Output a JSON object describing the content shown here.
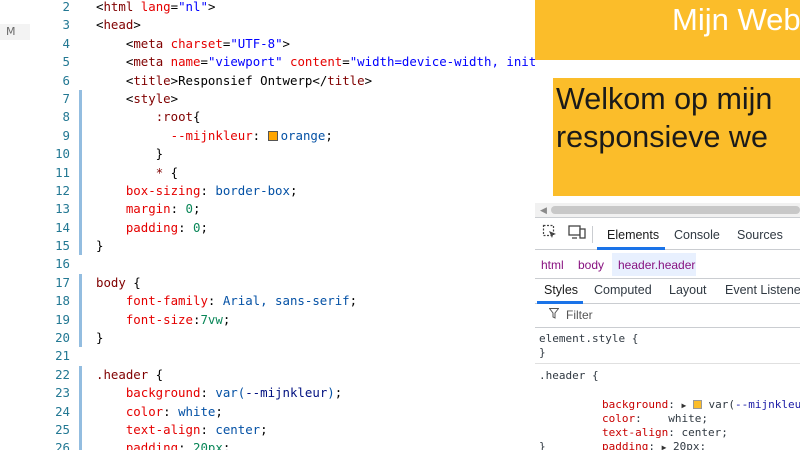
{
  "editor": {
    "git_badge": "M",
    "lines": [
      {
        "n": "2",
        "mod": false,
        "tokens": [
          [
            "t-punc",
            "<"
          ],
          [
            "t-tag",
            "html"
          ],
          [
            "t-punc",
            " "
          ],
          [
            "t-attr",
            "lang"
          ],
          [
            "t-punc",
            "="
          ],
          [
            "t-str",
            "\"nl\""
          ],
          [
            "t-punc",
            ">"
          ]
        ]
      },
      {
        "n": "3",
        "mod": false,
        "tokens": [
          [
            "t-punc",
            "<"
          ],
          [
            "t-tag",
            "head"
          ],
          [
            "t-punc",
            ">"
          ]
        ]
      },
      {
        "n": "4",
        "mod": false,
        "tokens": [
          [
            "t-punc",
            "    <"
          ],
          [
            "t-tag",
            "meta"
          ],
          [
            "t-punc",
            " "
          ],
          [
            "t-attr",
            "charset"
          ],
          [
            "t-punc",
            "="
          ],
          [
            "t-str",
            "\"UTF-8\""
          ],
          [
            "t-punc",
            ">"
          ]
        ]
      },
      {
        "n": "5",
        "mod": false,
        "tokens": [
          [
            "t-punc",
            "    <"
          ],
          [
            "t-tag",
            "meta"
          ],
          [
            "t-punc",
            " "
          ],
          [
            "t-attr",
            "name"
          ],
          [
            "t-punc",
            "="
          ],
          [
            "t-str",
            "\"viewport\""
          ],
          [
            "t-punc",
            " "
          ],
          [
            "t-attr",
            "content"
          ],
          [
            "t-punc",
            "="
          ],
          [
            "t-str",
            "\"width=device-width, init"
          ]
        ]
      },
      {
        "n": "6",
        "mod": false,
        "tokens": [
          [
            "t-punc",
            "    <"
          ],
          [
            "t-tag",
            "title"
          ],
          [
            "t-punc",
            ">Responsief Ontwerp</"
          ],
          [
            "t-tag",
            "title"
          ],
          [
            "t-punc",
            ">"
          ]
        ]
      },
      {
        "n": "7",
        "mod": true,
        "tokens": [
          [
            "t-punc",
            "    <"
          ],
          [
            "t-tag",
            "style"
          ],
          [
            "t-punc",
            ">"
          ]
        ]
      },
      {
        "n": "8",
        "mod": true,
        "tokens": [
          [
            "t-punc",
            "        "
          ],
          [
            "t-sel",
            ":root"
          ],
          [
            "t-punc",
            "{"
          ]
        ]
      },
      {
        "n": "9",
        "mod": true,
        "swatch_after": 1,
        "swatch_color": "orange",
        "tokens": [
          [
            "t-punc",
            "          "
          ],
          [
            "t-prop",
            "--mijnkleur"
          ],
          [
            "t-punc",
            ": "
          ],
          [
            "t-val",
            "orange"
          ],
          [
            "t-punc",
            ";"
          ]
        ]
      },
      {
        "n": "10",
        "mod": true,
        "tokens": [
          [
            "t-punc",
            "        }"
          ]
        ]
      },
      {
        "n": "11",
        "mod": true,
        "tokens": [
          [
            "t-punc",
            "        "
          ],
          [
            "t-sel",
            "* "
          ],
          [
            "t-punc",
            "{"
          ]
        ]
      },
      {
        "n": "12",
        "mod": true,
        "tokens": [
          [
            "t-punc",
            "    "
          ],
          [
            "t-prop",
            "box-sizing"
          ],
          [
            "t-punc",
            ": "
          ],
          [
            "t-val",
            "border-box"
          ],
          [
            "t-punc",
            ";"
          ]
        ]
      },
      {
        "n": "13",
        "mod": true,
        "tokens": [
          [
            "t-punc",
            "    "
          ],
          [
            "t-prop",
            "margin"
          ],
          [
            "t-punc",
            ": "
          ],
          [
            "t-num",
            "0"
          ],
          [
            "t-punc",
            ";"
          ]
        ]
      },
      {
        "n": "14",
        "mod": true,
        "tokens": [
          [
            "t-punc",
            "    "
          ],
          [
            "t-prop",
            "padding"
          ],
          [
            "t-punc",
            ": "
          ],
          [
            "t-num",
            "0"
          ],
          [
            "t-punc",
            ";"
          ]
        ]
      },
      {
        "n": "15",
        "mod": true,
        "tokens": [
          [
            "t-punc",
            "}"
          ]
        ]
      },
      {
        "n": "16",
        "mod": false,
        "tokens": []
      },
      {
        "n": "17",
        "mod": true,
        "tokens": [
          [
            "t-sel",
            "body"
          ],
          [
            "t-punc",
            " {"
          ]
        ]
      },
      {
        "n": "18",
        "mod": true,
        "tokens": [
          [
            "t-punc",
            "    "
          ],
          [
            "t-prop",
            "font-family"
          ],
          [
            "t-punc",
            ": "
          ],
          [
            "t-val",
            "Arial, sans-serif"
          ],
          [
            "t-punc",
            ";"
          ]
        ]
      },
      {
        "n": "19",
        "mod": true,
        "tokens": [
          [
            "t-punc",
            "    "
          ],
          [
            "t-prop",
            "font-size"
          ],
          [
            "t-punc",
            ":"
          ],
          [
            "t-num",
            "7vw"
          ],
          [
            "t-punc",
            ";"
          ]
        ]
      },
      {
        "n": "20",
        "mod": true,
        "tokens": [
          [
            "t-punc",
            "}"
          ]
        ]
      },
      {
        "n": "21",
        "mod": false,
        "tokens": []
      },
      {
        "n": "22",
        "mod": true,
        "tokens": [
          [
            "t-sel",
            ".header"
          ],
          [
            "t-punc",
            " {"
          ]
        ]
      },
      {
        "n": "23",
        "mod": true,
        "tokens": [
          [
            "t-punc",
            "    "
          ],
          [
            "t-prop",
            "background"
          ],
          [
            "t-punc",
            ": "
          ],
          [
            "t-val",
            "var("
          ],
          [
            "t-var",
            "--mijnkleur"
          ],
          [
            "t-val",
            ")"
          ],
          [
            "t-punc",
            ";"
          ]
        ]
      },
      {
        "n": "24",
        "mod": true,
        "swatch_after": 3,
        "swatch_color": "#ffffff",
        "tokens": [
          [
            "t-punc",
            "    "
          ],
          [
            "t-prop",
            "color"
          ],
          [
            "t-punc",
            ": "
          ],
          [
            "t-val",
            "white"
          ],
          [
            "t-punc",
            ";"
          ]
        ]
      },
      {
        "n": "25",
        "mod": true,
        "tokens": [
          [
            "t-punc",
            "    "
          ],
          [
            "t-prop",
            "text-align"
          ],
          [
            "t-punc",
            ": "
          ],
          [
            "t-val",
            "center"
          ],
          [
            "t-punc",
            ";"
          ]
        ]
      },
      {
        "n": "26",
        "mod": true,
        "tokens": [
          [
            "t-punc",
            "    "
          ],
          [
            "t-prop",
            "padding"
          ],
          [
            "t-punc",
            ": "
          ],
          [
            "t-num",
            "20px"
          ],
          [
            "t-punc",
            ";"
          ]
        ]
      }
    ]
  },
  "preview": {
    "site_title": "Mijn Web",
    "hero_line1": "Welkom op mijn",
    "hero_line2": "responsieve we",
    "header_color": "#fbbd2a"
  },
  "devtools": {
    "tabs": [
      "Elements",
      "Console",
      "Sources"
    ],
    "active_tab": "Elements",
    "breadcrumb": [
      "html",
      "body",
      "header.header"
    ],
    "subtabs": [
      "Styles",
      "Computed",
      "Layout",
      "Event Listeners"
    ],
    "active_subtab": "Styles",
    "filter_placeholder": "Filter",
    "element_style_open": "element.style {",
    "element_style_close": "}",
    "rule_selector": ".header {",
    "rule_props": [
      {
        "prop": "background",
        "arrow": true,
        "swatch": true,
        "value_pre": "var(",
        "value_var": "--mijnkleur",
        "value_post": ");"
      },
      {
        "prop": "color",
        "arrow": false,
        "swatch": false,
        "value_pre": "   white;",
        "value_var": "",
        "value_post": ""
      },
      {
        "prop": "text-align",
        "arrow": false,
        "swatch": false,
        "value_pre": "center;",
        "value_var": "",
        "value_post": ""
      },
      {
        "prop": "padding",
        "arrow": true,
        "swatch": false,
        "value_pre": "20px;",
        "value_var": "",
        "value_post": ""
      }
    ],
    "rule_close": "}"
  }
}
